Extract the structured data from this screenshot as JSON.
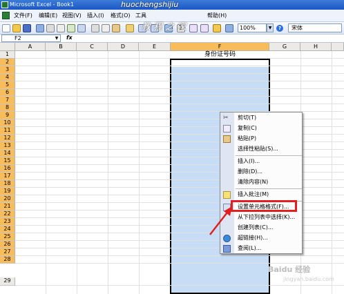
{
  "window": {
    "title": "Microsoft Excel - Book1"
  },
  "menu": {
    "items": [
      "文件(F)",
      "编辑(E)",
      "视图(V)",
      "插入(I)",
      "格式(O)",
      "工具",
      "",
      "帮助(H)"
    ]
  },
  "toolbar": {
    "zoom": "100%",
    "font": "宋体"
  },
  "formula_bar": {
    "name_box": "F2",
    "fx": "fx"
  },
  "columns": [
    "A",
    "B",
    "C",
    "D",
    "E",
    "F",
    "G",
    "H"
  ],
  "rows": [
    "1",
    "2",
    "3",
    "4",
    "5",
    "6",
    "7",
    "8",
    "9",
    "10",
    "11",
    "12",
    "13",
    "14",
    "15",
    "16",
    "17",
    "18",
    "19",
    "20",
    "21",
    "22",
    "23",
    "24",
    "25",
    "26",
    "27",
    "28",
    "29"
  ],
  "cells": {
    "F1": "身份证号码"
  },
  "context_menu": {
    "items": [
      {
        "label": "剪切(T)",
        "icon": "scissors-icon"
      },
      {
        "label": "复制(C)",
        "icon": "copy-icon"
      },
      {
        "label": "粘贴(P)",
        "icon": "paste-icon"
      },
      {
        "label": "选择性粘贴(S)...",
        "icon": ""
      },
      {
        "label": "插入(I)...",
        "icon": ""
      },
      {
        "label": "删除(D)...",
        "icon": ""
      },
      {
        "label": "清除内容(N)",
        "icon": ""
      },
      {
        "label": "插入批注(M)",
        "icon": "comment-icon"
      },
      {
        "label": "设置单元格格式(F)...",
        "icon": "format-cells-icon"
      },
      {
        "label": "从下拉列表中选择(K)...",
        "icon": ""
      },
      {
        "label": "创建列表(C)...",
        "icon": ""
      },
      {
        "label": "超链接(H)...",
        "icon": "hyperlink-icon"
      },
      {
        "label": "查阅(L)...",
        "icon": "lookup-icon"
      }
    ]
  },
  "watermarks": {
    "top": "huochengshijiu",
    "top2": "教 程 之 家",
    "bottom": "Baidu 经验",
    "bottom2": "jingyan.baidu.com"
  },
  "colors": {
    "selection": "#c7dcf5",
    "header_selected": "#f8bc5b",
    "highlight": "#e02020"
  }
}
